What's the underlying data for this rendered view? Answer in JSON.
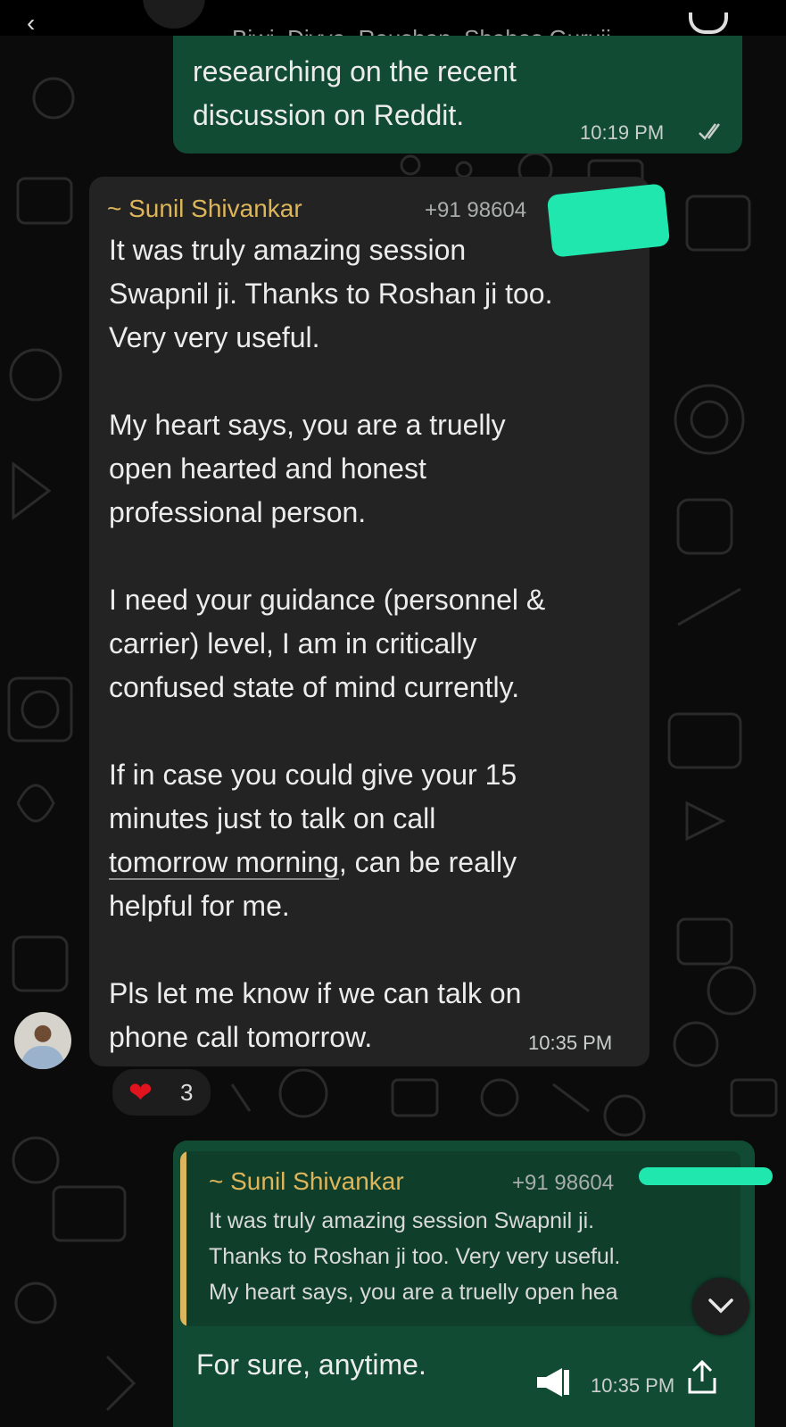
{
  "header": {
    "participants": "Biwi, Divya, Roushan, Shabas Guruji,..."
  },
  "messages": {
    "outgoing_top": {
      "text": "researching on the recent\ndiscussion on Reddit.",
      "time": "10:19 PM",
      "status": "read-double-tick"
    },
    "incoming": {
      "sender": "~ Sunil Shivankar",
      "phone": "+91 98604",
      "text_part1": "It was truly amazing session\nSwapnil ji. Thanks to Roshan ji too.\nVery very useful.\n\nMy heart says, you are a truelly\nopen hearted and honest\nprofessional person.\n\nI need your guidance (personnel &\ncarrier) level, I am in critically\nconfused state of mind currently.\n\nIf in case you could give your 15\nminutes just to talk on call\n",
      "text_underlined": "tomorrow morning",
      "text_part2": ", can be really\nhelpful for me.\n\nPls let me know if we can talk on\nphone call tomorrow.",
      "time": "10:35 PM",
      "reaction": {
        "emoji": "heart",
        "count": "3"
      }
    },
    "reply": {
      "quoted_sender": "~ Sunil Shivankar",
      "quoted_phone": "+91 98604",
      "quoted_text": "It was truly amazing session Swapnil ji.\nThanks to Roshan ji too. Very very useful.\nMy heart says, you are a truelly open hea",
      "text": "For sure, anytime.",
      "time": "10:35 PM"
    }
  },
  "colors": {
    "outgoing_bubble": "#114b33",
    "incoming_bubble": "#232323",
    "sender_name": "#ddb55a",
    "redaction": "#20e7ad"
  }
}
